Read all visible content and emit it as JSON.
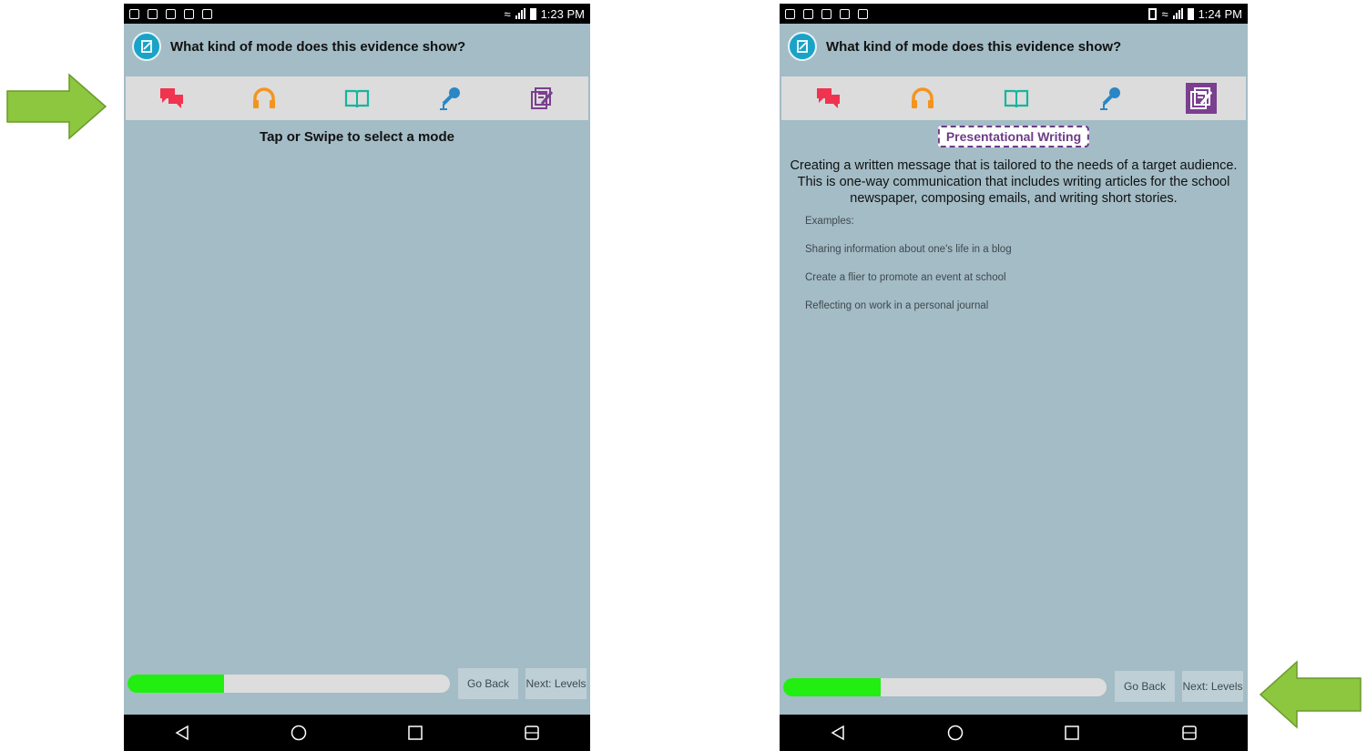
{
  "left": {
    "status": {
      "time": "1:23 PM"
    },
    "question": "What kind of mode does this evidence show?",
    "hint": "Tap or Swipe to select a mode",
    "progress": 0.3,
    "buttons": {
      "back": "Go Back",
      "next": "Next: Levels"
    }
  },
  "right": {
    "status": {
      "time": "1:24 PM"
    },
    "question": "What kind of mode does this evidence show?",
    "selected_mode": "Presentational Writing",
    "description": "Creating a written message that is tailored to the needs of a target audience. This is one-way communication that includes writing articles for the school newspaper, composing emails, and writing short stories.",
    "examples": [
      "Examples:",
      "Sharing information about one's life in a blog",
      "Create a flier to promote an event at school",
      "Reflecting on work in a personal journal"
    ],
    "progress": 0.3,
    "buttons": {
      "back": "Go Back",
      "next": "Next: Levels"
    }
  },
  "modes": [
    {
      "icon": "chat-bubbles-icon",
      "color": "#f0334f"
    },
    {
      "icon": "headphones-icon",
      "color": "#f5941d"
    },
    {
      "icon": "open-book-icon",
      "color": "#16b59e"
    },
    {
      "icon": "microphone-icon",
      "color": "#2a86c5"
    },
    {
      "icon": "writing-icon",
      "color": "#7b3f8f"
    }
  ],
  "colors": {
    "arrow": "#8dc63f",
    "progress": "#22ee11",
    "accent": "#7b3f8f"
  }
}
